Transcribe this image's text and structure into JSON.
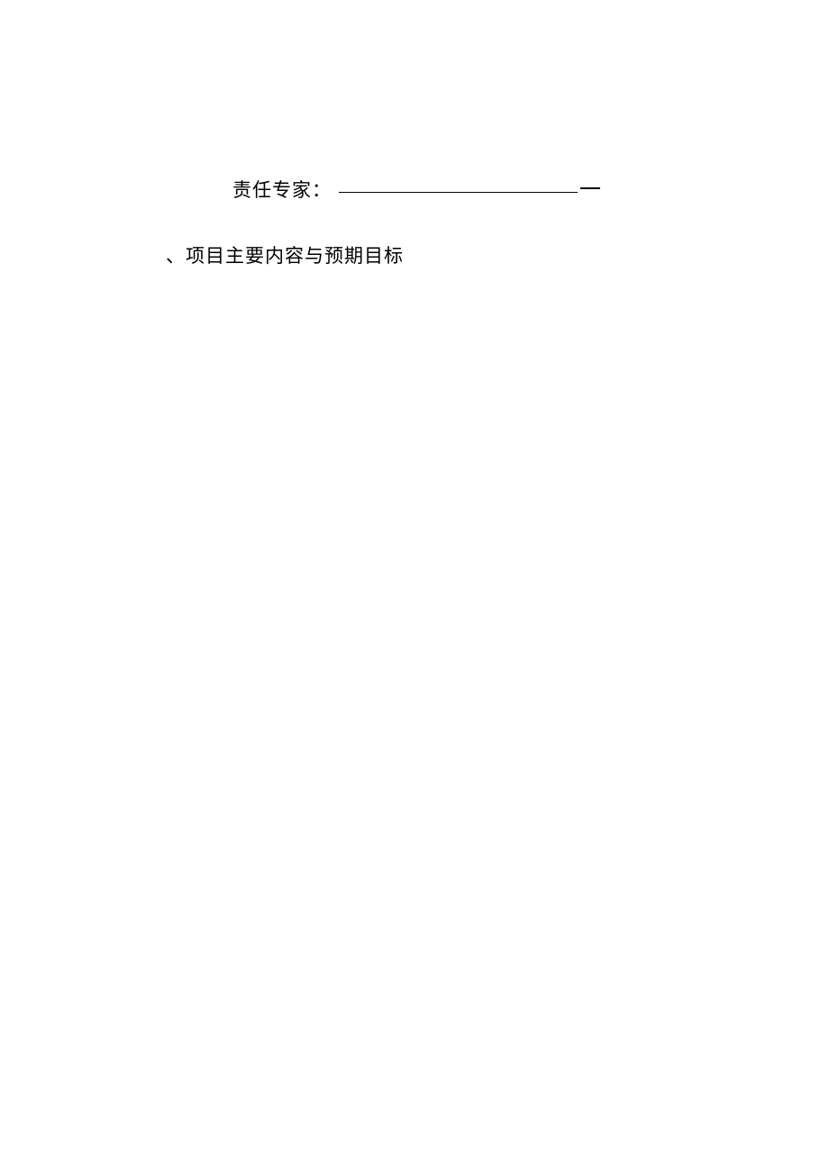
{
  "form": {
    "expert_label": "责任专家：",
    "section_heading": "、项目主要内容与预期目标"
  }
}
